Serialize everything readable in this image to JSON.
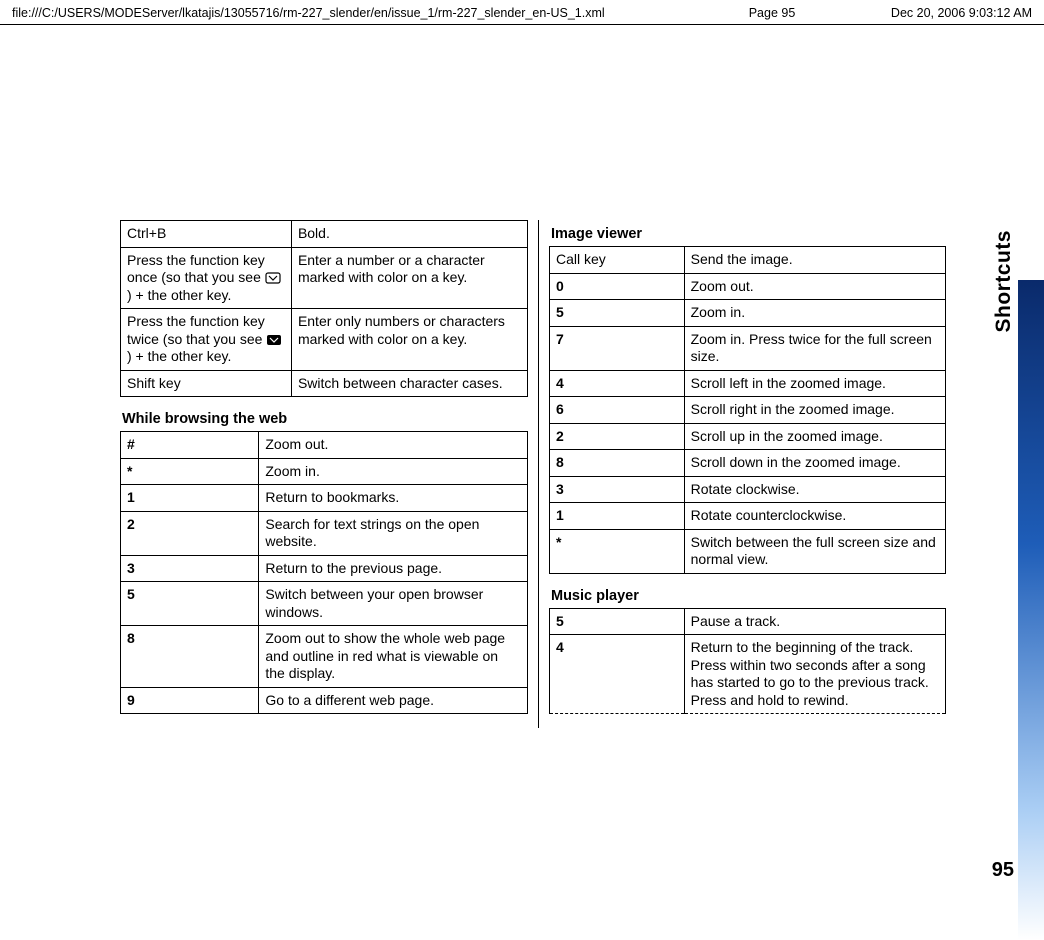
{
  "header": {
    "path": "file:///C:/USERS/MODEServer/lkatajis/13055716/rm-227_slender/en/issue_1/rm-227_slender_en-US_1.xml",
    "page": "Page 95",
    "timestamp": "Dec 20, 2006 9:03:12 AM"
  },
  "side": {
    "label": "Shortcuts",
    "page_number": "95"
  },
  "text_editing": {
    "rows": [
      {
        "key": "Ctrl+B",
        "desc": "Bold."
      },
      {
        "key_prefix": "Press the function key once (so that you see ",
        "key_suffix": ") + the other key.",
        "icon": "fn-once-icon",
        "desc": "Enter a number or a character marked with color on a key."
      },
      {
        "key_prefix": "Press the function key twice (so that you see ",
        "key_suffix": ") + the other key.",
        "icon": "fn-twice-icon",
        "desc": "Enter only numbers or characters marked with color on a key."
      },
      {
        "key": "Shift key",
        "desc": "Switch between character cases."
      }
    ]
  },
  "browsing": {
    "title": "While browsing the web",
    "rows": [
      {
        "key": "#",
        "desc": "Zoom out."
      },
      {
        "key": "*",
        "desc": "Zoom in."
      },
      {
        "key": "1",
        "desc": "Return to bookmarks."
      },
      {
        "key": "2",
        "desc": "Search for text strings on the open website."
      },
      {
        "key": "3",
        "desc": "Return to the previous page."
      },
      {
        "key": "5",
        "desc": "Switch between your open browser windows."
      },
      {
        "key": "8",
        "desc": "Zoom out to show the whole web page and outline in red what is viewable on the display."
      },
      {
        "key": "9",
        "desc": "Go to a different web page."
      }
    ]
  },
  "image_viewer": {
    "title": "Image viewer",
    "rows": [
      {
        "key": "Call key",
        "desc": "Send the image."
      },
      {
        "key": "0",
        "desc": "Zoom out."
      },
      {
        "key": "5",
        "desc": "Zoom in."
      },
      {
        "key": "7",
        "desc": "Zoom in. Press twice for the full screen size."
      },
      {
        "key": "4",
        "desc": "Scroll left in the zoomed image."
      },
      {
        "key": "6",
        "desc": "Scroll right in the zoomed image."
      },
      {
        "key": "2",
        "desc": "Scroll up in the zoomed image."
      },
      {
        "key": "8",
        "desc": "Scroll down in the zoomed image."
      },
      {
        "key": "3",
        "desc": "Rotate clockwise."
      },
      {
        "key": "1",
        "desc": "Rotate counterclockwise."
      },
      {
        "key": "*",
        "desc": "Switch between the full screen size and normal view."
      }
    ]
  },
  "music_player": {
    "title": "Music player",
    "rows": [
      {
        "key": "5",
        "desc": "Pause a track."
      },
      {
        "key": "4",
        "desc": "Return to the beginning of the track. Press within two seconds after a song has started to go to the previous track. Press and hold to rewind."
      }
    ]
  }
}
